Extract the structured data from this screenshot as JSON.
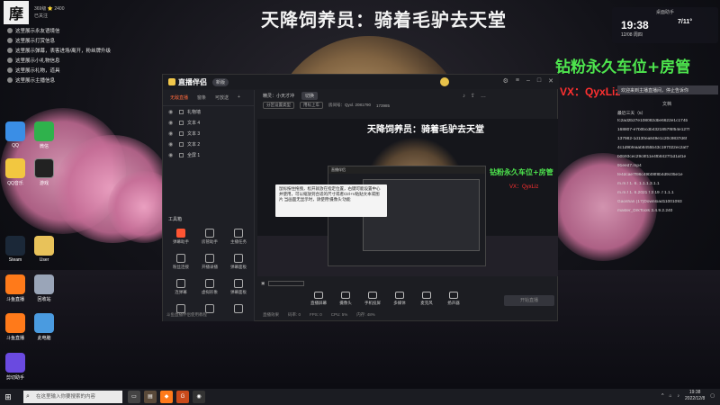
{
  "overlay": {
    "banner": "天降饲养员：骑着毛驴去天堂",
    "fan_label": "钻粉永久车位+房管",
    "vx": "VX：QyxLiz"
  },
  "top_left": {
    "logo_char": "摩",
    "stats_line1": "369级 ⭐ 2400",
    "stats_line2": "已关注",
    "notices": [
      "这里展示永友语境信",
      "这里展示打赏信息",
      "这里展示弹幕，表客进场/离开，粉丝牌升级",
      "这里展示小礼物信息",
      "这里展示礼物，道具",
      "这里展示主播信息"
    ]
  },
  "desktop_icons": [
    {
      "label": "QQ"
    },
    {
      "label": "微信"
    },
    {
      "label": "QQ音乐"
    },
    {
      "label": "游戏"
    },
    {
      "label": "Steam"
    },
    {
      "label": "User"
    },
    {
      "label": "斗鱼直播"
    },
    {
      "label": "回收站"
    },
    {
      "label": "斗鱼直播"
    },
    {
      "label": "此电脑"
    },
    {
      "label": "剪切助手"
    }
  ],
  "widget": {
    "title": "桌面助手",
    "time": "19:38",
    "date": "12/08 周四",
    "date2": "7/11°",
    "icons": "● ☼ ♫ ☁"
  },
  "right_panel": {
    "strip": "欢迎来到主播直播间，停止告诉你",
    "title": "文档",
    "recent_label": "最近三天（5）",
    "files": [
      "fc2ad2b27e108082dbe6622e1c174b",
      "168807-e7b0bcdb4321857f6f54e127f",
      "137982-1d130ea849e1c20c9837d6f",
      "4c1d9bfeaab8455b43c197022ec2af7",
      "b0b93cec29c8f11e4fb8427f1d1af1e",
      "91eed7.mp4",
      "fe4dcae7f96c49b08f8b4d9c05e1e",
      "m.m.f 1. 6. 1.1.1.3.1.1",
      "m.m.f 1. 6.2021 f 3 19 .f 1.1.1",
      "Gaoshan (17)Download11001093",
      "master_DrkTools 3.4.9.2.240"
    ]
  },
  "app": {
    "title": "直播伴侣",
    "version": "新版",
    "tabs": [
      "无敌直播",
      "窗条",
      "可放送"
    ],
    "active_tab": "无敌直播",
    "sources": [
      "礼物墙",
      "文本 4",
      "文本 3",
      "文本 2",
      "全屏 1"
    ],
    "tools_label": "工具箱",
    "tools": [
      "弹幕助手",
      "房管助手",
      "主播任务",
      "粉丝连接",
      "开播录播",
      "弹幕面板",
      "连弹幕",
      "虚拟形象",
      "弹幕面板",
      "",
      "",
      ""
    ],
    "left_footer": "斗鱼直播伴侣使用教程",
    "info_bar": {
      "title": "精灵：小天才冲",
      "btn": "切换",
      "room": "房间号：Qyxl.  2081790",
      "viewers": "173985"
    },
    "chips": [
      "分区设置类型",
      "用标上车"
    ],
    "preview": {
      "title": "天降饲养员：骑着毛驴去天堂",
      "fan": "钻粉永久车位+房管",
      "vx": "VX：QyxLiz",
      "tooltip": "鼠标按住拖拽，松开就放在指定位置，右键可能设置中心并使用，可以缩放到合适的尺寸或者Ctrl+V粘贴文本或图片 当画面无显示时，请使用'摄像头'功能"
    },
    "actions": [
      "直播屏幕",
      "摄像头",
      "手机投屏",
      "多媒体",
      "麦克风",
      "扬声器"
    ],
    "start_button": "开始直播",
    "status": [
      "直播效果",
      "码率: 0",
      "FPS: 0",
      "CPU: 5%",
      "内存: 48%"
    ]
  },
  "taskbar": {
    "search_placeholder": "在这里输入你要搜索的内容",
    "time": "19:38",
    "date": "2022/12/8"
  }
}
